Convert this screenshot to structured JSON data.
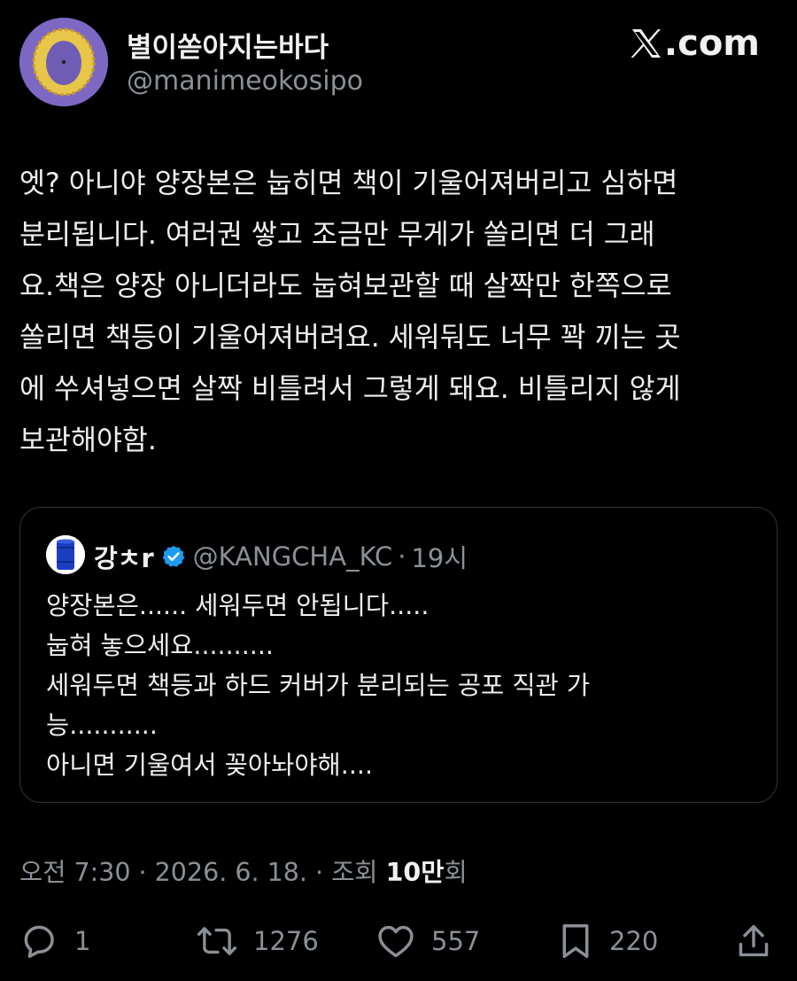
{
  "author": {
    "display_name": "별이쏟아지는바다",
    "handle": "@manimeokosipo"
  },
  "brand": {
    "label": ".com"
  },
  "tweet": {
    "lines": [
      "엣? 아니야 양장본은 눕히면 책이 기울어져버리고 심하면",
      "분리됩니다. 여러권 쌓고 조금만 무게가 쏠리면 더 그래",
      "요.책은 양장 아니더라도 눕혀보관할 때 살짝만 한쪽으로",
      "쏠리면 책등이 기울어져버려요. 세워둬도 너무 꽉 끼는 곳",
      "에 쑤셔넣으면 살짝 비틀려서 그렇게 돼요. 비틀리지 않게",
      "보관해야함."
    ]
  },
  "quote": {
    "name": "강ㅊr",
    "handle": "@KANGCHA_KC",
    "separator": "·",
    "time": "19시",
    "lines": [
      "양장본은...... 세워두면 안됩니다.....",
      "눕혀 놓으세요..........",
      "세워두면 책등과 하드 커버가 분리되는 공포 직관 가",
      "능...........",
      "아니면 기울여서 꽂아놔야해...."
    ]
  },
  "meta": {
    "time_date": "오전 7:30 · 2026. 6. 18. · 조회 ",
    "views_count": "10만",
    "views_suffix": "회"
  },
  "actions": {
    "replies": "1",
    "retweets": "1276",
    "likes": "557",
    "bookmarks": "220"
  },
  "icons": {
    "avatar": "picture-frame-icon",
    "quote_avatar": "blue-barrel-icon",
    "verified": "verified-badge-icon",
    "reply": "reply-icon",
    "retweet": "retweet-icon",
    "like": "heart-icon",
    "bookmark": "bookmark-icon",
    "share": "share-icon"
  },
  "colors": {
    "background": "#000000",
    "text": "#e7e9ea",
    "muted": "#8b9096",
    "verified": "#1d9bf0"
  }
}
